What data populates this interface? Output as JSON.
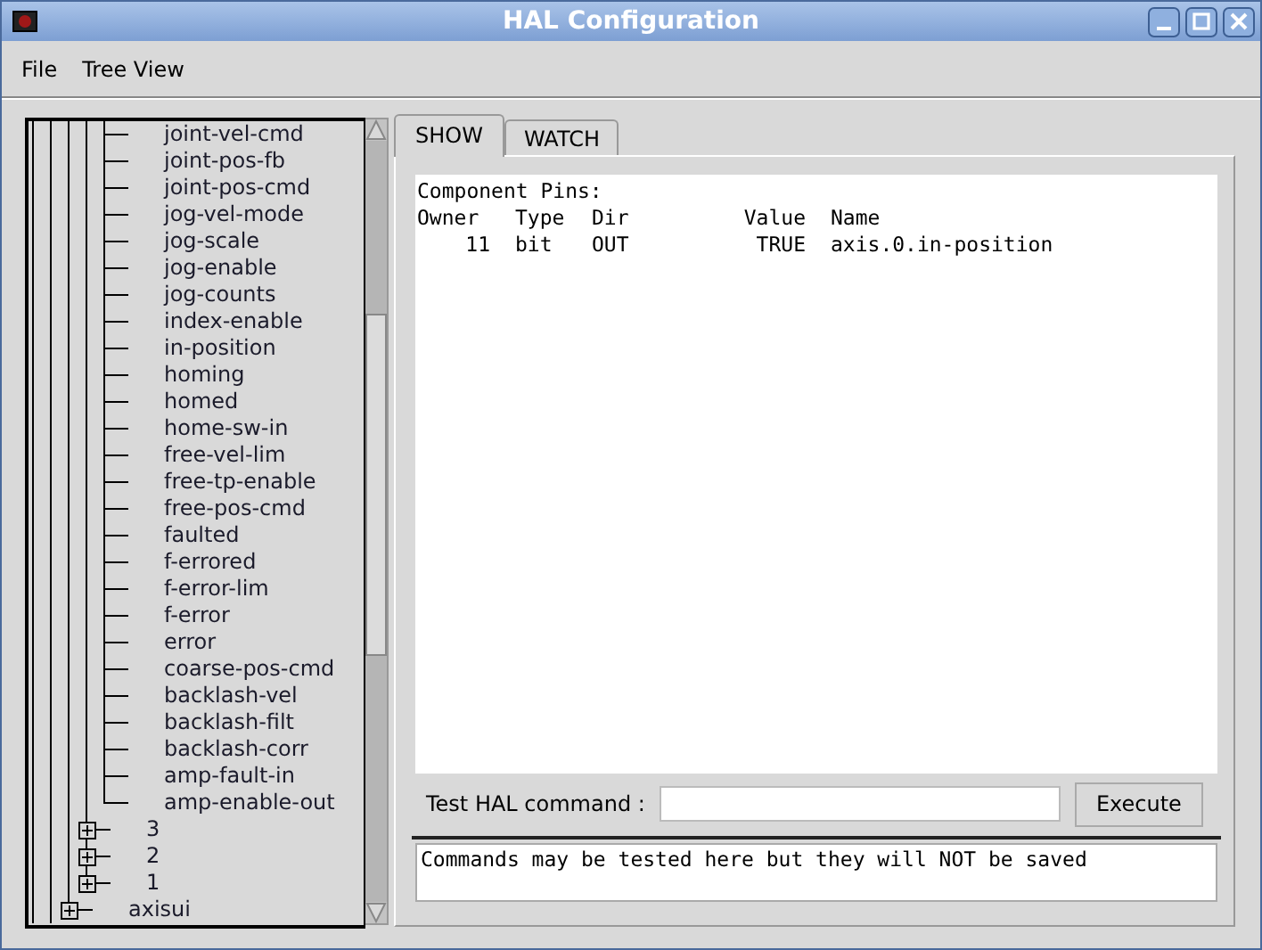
{
  "window": {
    "title": "HAL Configuration"
  },
  "menu": [
    "File",
    "Tree View"
  ],
  "tree": [
    {
      "children": [
        {
          "children": [
            {
              "children": [
                {
                  "children": [
                    {
                      "children": [
                        {
                          "label": "joint-vel-cmd"
                        },
                        {
                          "label": "joint-pos-fb"
                        },
                        {
                          "label": "joint-pos-cmd"
                        },
                        {
                          "label": "jog-vel-mode"
                        },
                        {
                          "label": "jog-scale"
                        },
                        {
                          "label": "jog-enable"
                        },
                        {
                          "label": "jog-counts"
                        },
                        {
                          "label": "index-enable"
                        },
                        {
                          "label": "in-position"
                        },
                        {
                          "label": "homing"
                        },
                        {
                          "label": "homed"
                        },
                        {
                          "label": "home-sw-in"
                        },
                        {
                          "label": "free-vel-lim"
                        },
                        {
                          "label": "free-tp-enable"
                        },
                        {
                          "label": "free-pos-cmd"
                        },
                        {
                          "label": "faulted"
                        },
                        {
                          "label": "f-errored"
                        },
                        {
                          "label": "f-error-lim"
                        },
                        {
                          "label": "f-error"
                        },
                        {
                          "label": "error"
                        },
                        {
                          "label": "coarse-pos-cmd"
                        },
                        {
                          "label": "backlash-vel"
                        },
                        {
                          "label": "backlash-filt"
                        },
                        {
                          "label": "backlash-corr"
                        },
                        {
                          "label": "amp-fault-in"
                        },
                        {
                          "label": "amp-enable-out"
                        }
                      ]
                    },
                    {
                      "label": "3",
                      "expanded": false
                    },
                    {
                      "label": "2",
                      "expanded": false
                    },
                    {
                      "label": "1",
                      "expanded": false
                    }
                  ]
                },
                {
                  "label": "axisui",
                  "expanded": false
                }
              ]
            }
          ]
        }
      ]
    }
  ],
  "tabs": [
    {
      "label": "SHOW",
      "selected": true
    },
    {
      "label": "WATCH",
      "selected": false
    }
  ],
  "show": {
    "heading": "Component Pins:",
    "columns": [
      "Owner",
      "Type",
      "Dir",
      "Value",
      "Name"
    ],
    "rows": [
      [
        "11",
        "bit",
        "OUT",
        "TRUE",
        "axis.0.in-position"
      ]
    ]
  },
  "command": {
    "label": "Test HAL command :",
    "button": "Execute",
    "output": "Commands may be tested here but they will NOT be saved"
  }
}
